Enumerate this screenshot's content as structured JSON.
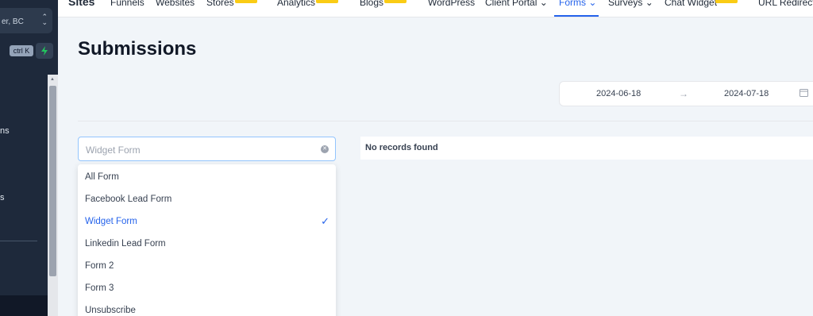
{
  "sidebar": {
    "location_text": "er, BC",
    "search_shortcut": "ctrl K",
    "partial_items": [
      "ns",
      "s"
    ]
  },
  "topnav": {
    "brand": "Sites",
    "items": [
      {
        "label": "Funnels"
      },
      {
        "label": "Websites"
      },
      {
        "label": "Stores"
      },
      {
        "label": "Analytics"
      },
      {
        "label": "Blogs"
      },
      {
        "label": "WordPress"
      },
      {
        "label": "Client Portal"
      },
      {
        "label": "Forms"
      },
      {
        "label": "Surveys"
      },
      {
        "label": "Chat Widget"
      },
      {
        "label": "URL Redirects"
      }
    ],
    "active": "Forms",
    "badge_color": "#facc15",
    "accent": "#2563eb"
  },
  "page": {
    "title": "Submissions"
  },
  "date_range": {
    "start": "2024-06-18",
    "separator": "→",
    "end": "2024-07-18"
  },
  "form_select": {
    "value": "Widget Form"
  },
  "dropdown": {
    "options": [
      {
        "label": "All Form"
      },
      {
        "label": "Facebook Lead Form"
      },
      {
        "label": "Widget Form"
      },
      {
        "label": "Linkedin Lead Form"
      },
      {
        "label": "Form 2"
      },
      {
        "label": "Form 3"
      },
      {
        "label": "Unsubscribe"
      }
    ],
    "selected": "Widget Form"
  },
  "results": {
    "empty_text": "No records found"
  }
}
